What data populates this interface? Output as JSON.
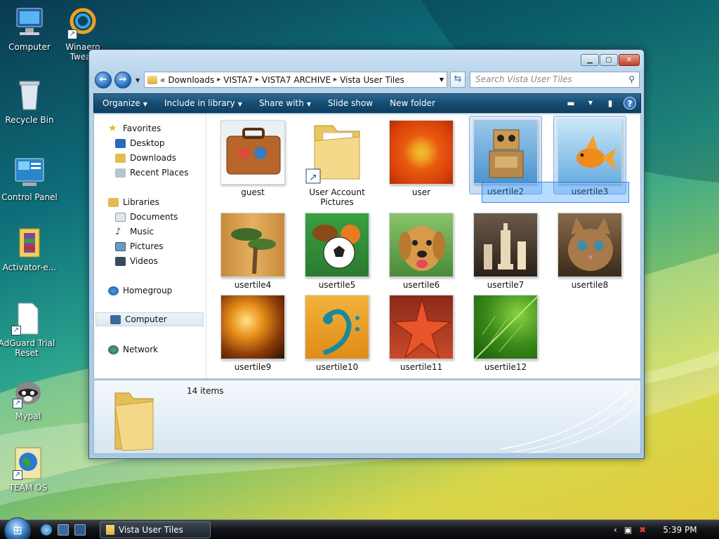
{
  "desktop": {
    "icons": [
      {
        "label": "Computer"
      },
      {
        "label": "Winaero Tweak"
      },
      {
        "label": "Recycle Bin"
      },
      {
        "label": "Control Panel"
      },
      {
        "label": "Activator-e..."
      },
      {
        "label": "AdGuard Trial Reset"
      },
      {
        "label": "Mypal"
      },
      {
        "label": "TEAM OS"
      }
    ]
  },
  "window": {
    "breadcrumb": [
      "Downloads",
      "VISTA7",
      "VISTA7 ARCHIVE",
      "Vista User Tiles"
    ],
    "breadcrumb_prefix": "«",
    "search_placeholder": "Search Vista User Tiles",
    "toolbar": {
      "organize": "Organize",
      "include_in_library": "Include in library",
      "share_with": "Share with",
      "slide_show": "Slide show",
      "new_folder": "New folder"
    },
    "nav_pane": {
      "favorites": "Favorites",
      "favorites_items": [
        "Desktop",
        "Downloads",
        "Recent Places"
      ],
      "libraries": "Libraries",
      "libraries_items": [
        "Documents",
        "Music",
        "Pictures",
        "Videos"
      ],
      "homegroup": "Homegroup",
      "computer": "Computer",
      "network": "Network"
    },
    "files": [
      {
        "name": "guest"
      },
      {
        "name": "User Account Pictures"
      },
      {
        "name": "user"
      },
      {
        "name": "usertile2"
      },
      {
        "name": "usertile3"
      },
      {
        "name": "usertile4"
      },
      {
        "name": "usertile5"
      },
      {
        "name": "usertile6"
      },
      {
        "name": "usertile7"
      },
      {
        "name": "usertile8"
      },
      {
        "name": "usertile9"
      },
      {
        "name": "usertile10"
      },
      {
        "name": "usertile11"
      },
      {
        "name": "usertile12"
      }
    ],
    "details": {
      "item_count": "14 items"
    }
  },
  "taskbar": {
    "active_window": "Vista User Tiles",
    "clock": "5:39 PM"
  },
  "colors": {
    "toolbar": "#154d72",
    "selection": "#c3dcf5",
    "accent": "#1f63b4"
  }
}
